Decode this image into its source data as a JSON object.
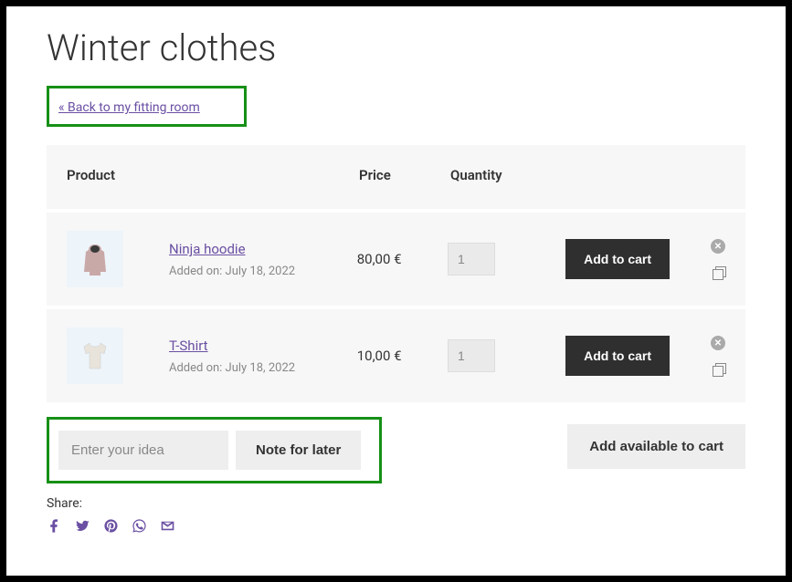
{
  "title": "Winter clothes",
  "back_link": "« Back to my fitting room",
  "columns": {
    "product": "Product",
    "price": "Price",
    "quantity": "Quantity"
  },
  "items": [
    {
      "name": "Ninja hoodie",
      "added": "Added on: July 18, 2022",
      "price": "80,00 €",
      "qty": "1",
      "button": "Add to cart"
    },
    {
      "name": "T-Shirt",
      "added": "Added on: July 18, 2022",
      "price": "10,00 €",
      "qty": "1",
      "button": "Add to cart"
    }
  ],
  "idea_placeholder": "Enter your idea",
  "note_button": "Note for later",
  "add_available": "Add available to cart",
  "share_label": "Share:"
}
